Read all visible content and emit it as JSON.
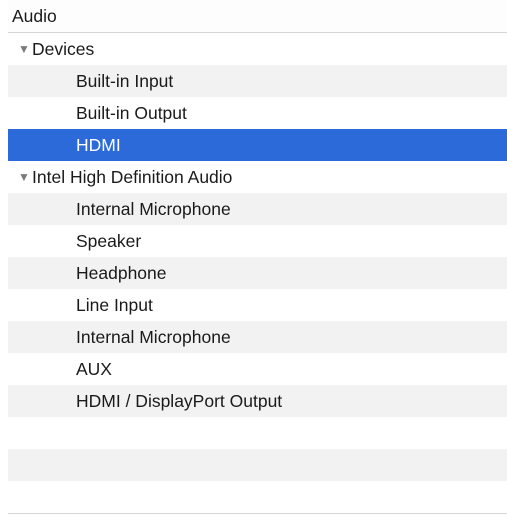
{
  "list": {
    "header": "Audio",
    "groups": [
      {
        "label": "Devices",
        "items": [
          "Built-in Input",
          "Built-in Output",
          "HDMI"
        ]
      },
      {
        "label": "Intel High Definition Audio",
        "items": [
          "Internal Microphone",
          "Speaker",
          "Headphone",
          "Line Input",
          "Internal Microphone",
          "AUX",
          "HDMI / DisplayPort Output"
        ]
      }
    ],
    "selected_item": "HDMI",
    "disclosure_glyph": "▼"
  },
  "colors": {
    "selection": "#2b6ad8",
    "alt_row": "#f2f2f2",
    "row": "#ffffff",
    "divider": "#d6d6d6"
  }
}
